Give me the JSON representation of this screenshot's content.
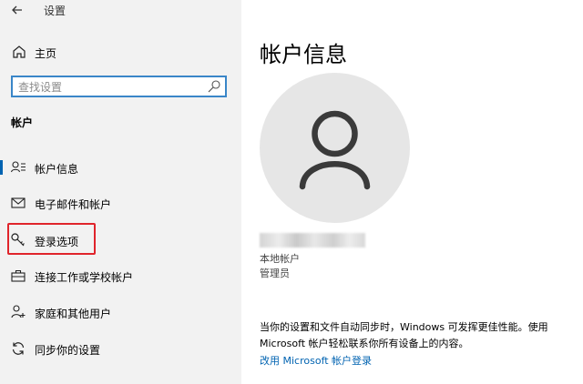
{
  "titlebar": {
    "title": "设置",
    "back_icon": "arrow-left-icon"
  },
  "sidebar": {
    "home_label": "主页",
    "search_placeholder": "查找设置",
    "section_title": "帐户",
    "items": [
      {
        "label": "帐户信息",
        "icon": "account-info-icon",
        "selected": true
      },
      {
        "label": "电子邮件和帐户",
        "icon": "email-icon",
        "selected": false
      },
      {
        "label": "登录选项",
        "icon": "key-icon",
        "selected": false,
        "highlighted": true
      },
      {
        "label": "连接工作或学校帐户",
        "icon": "briefcase-icon",
        "selected": false
      },
      {
        "label": "家庭和其他用户",
        "icon": "add-person-icon",
        "selected": false
      },
      {
        "label": "同步你的设置",
        "icon": "sync-icon",
        "selected": false
      }
    ]
  },
  "main": {
    "page_title": "帐户信息",
    "account_type": "本地帐户",
    "account_role": "管理员",
    "description": "当你的设置和文件自动同步时，Windows 可发挥更佳性能。使用 Microsoft 帐户轻松联系你所有设备上的内容。",
    "ms_link": "改用 Microsoft 帐户登录"
  },
  "colors": {
    "accent": "#0063b1",
    "highlight_border": "#e0242b",
    "sidebar_bg": "#f2f2f2",
    "search_border": "#3a86c8"
  }
}
